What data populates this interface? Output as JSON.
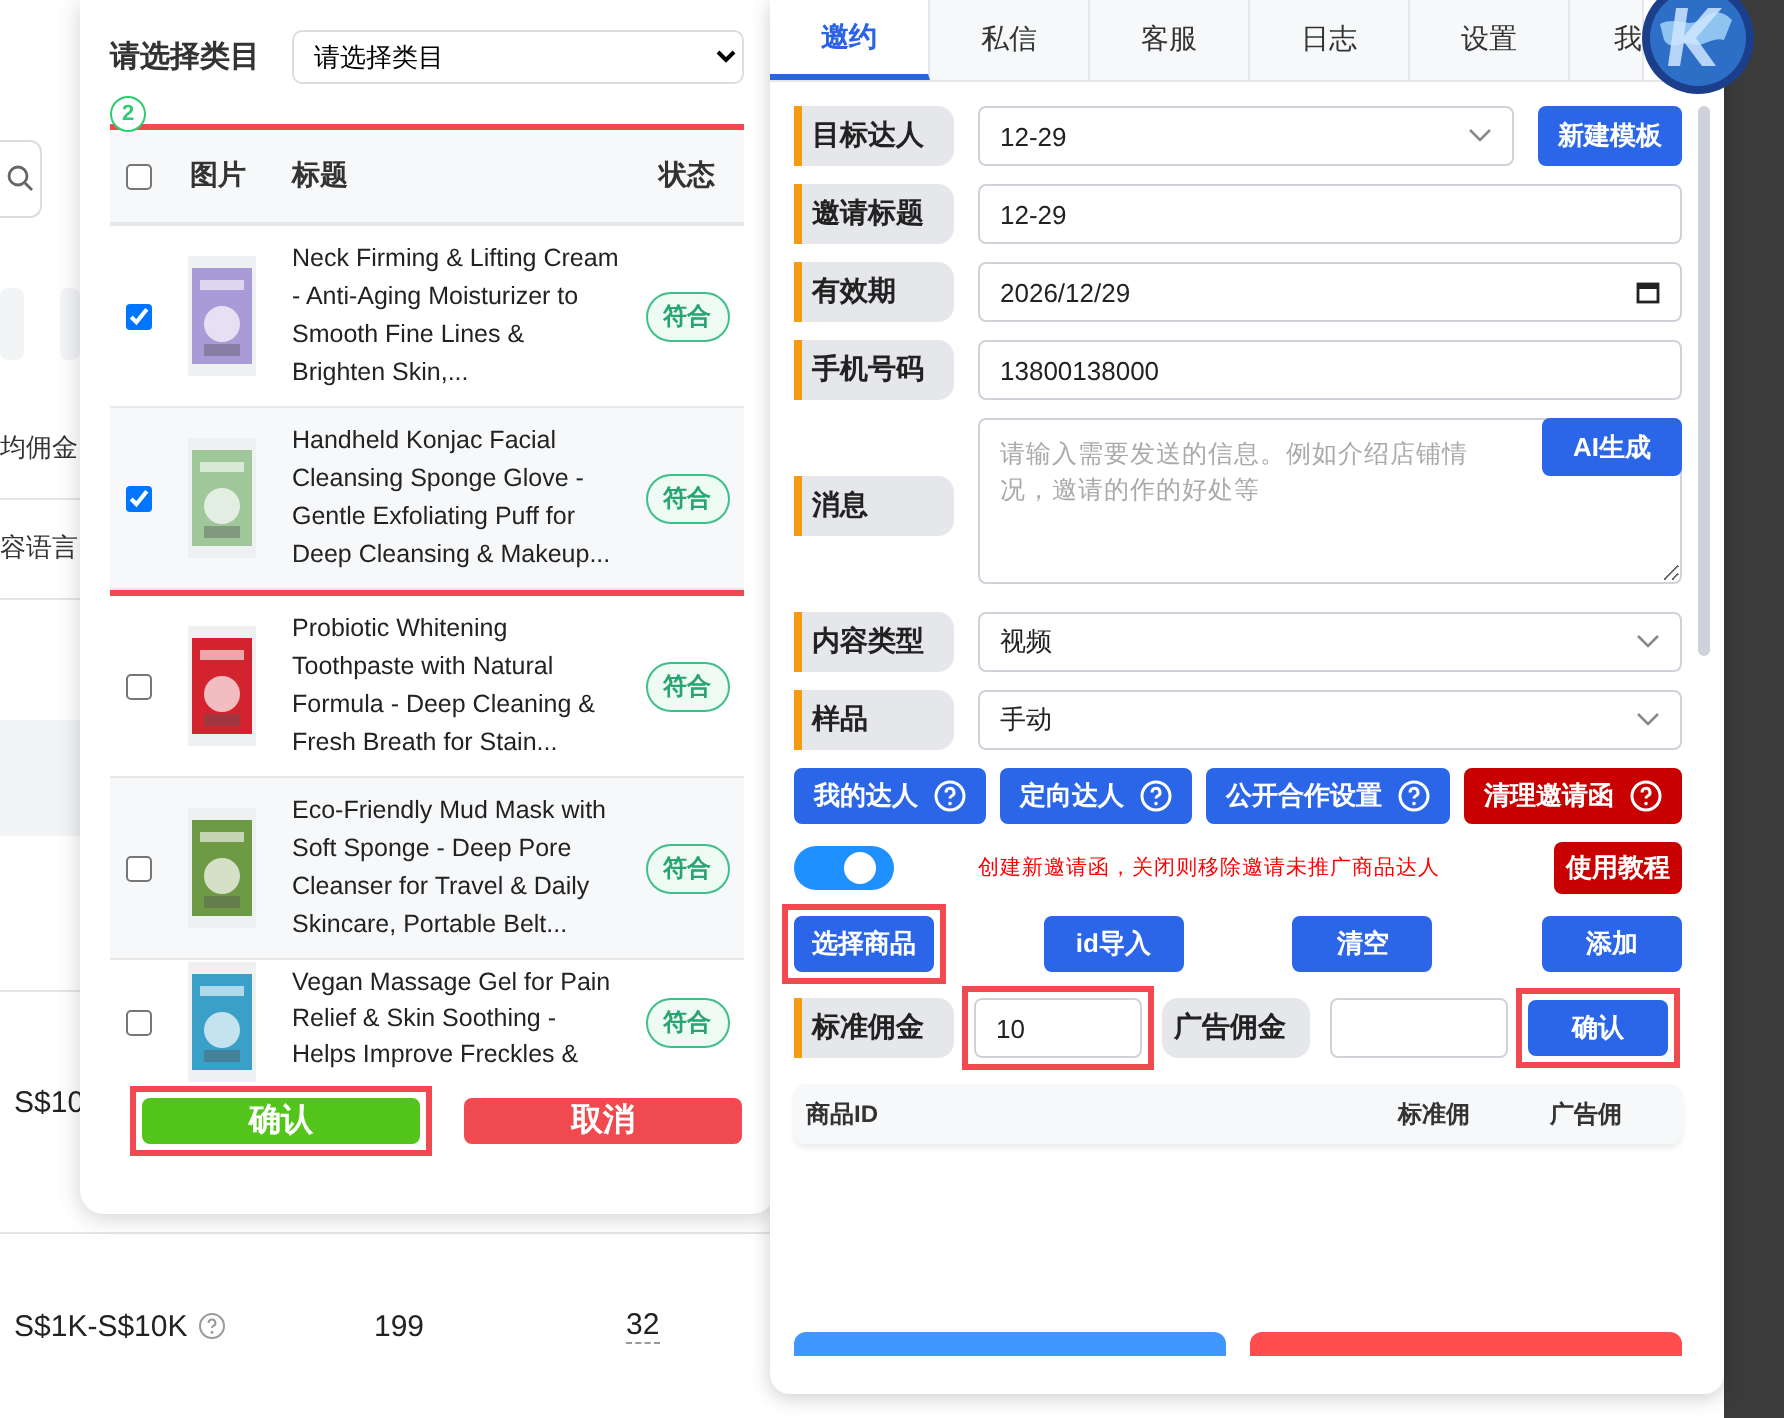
{
  "background_page": {
    "filter_labels": [
      "均佣金",
      "容语言"
    ],
    "rows": [
      {
        "column_1": "S$10"
      },
      {
        "column_1": "S$1K-S$10K",
        "column_2": "199",
        "column_3": "32"
      }
    ]
  },
  "product_picker": {
    "category_label": "请选择类目",
    "category_select": {
      "value": "请选择类目"
    },
    "step_marker": "2",
    "columns": [
      "图片",
      "标题",
      "状态"
    ],
    "select_all": {
      "checked": false
    },
    "header_highlighted": true,
    "products": [
      {
        "checked": true,
        "highlighted": true,
        "title": "Neck Firming & Lifting Cream - Anti-Aging Moisturizer to Smooth Fine Lines & Brighten Skin,...",
        "status": "符合"
      },
      {
        "checked": true,
        "highlighted": true,
        "title": "Handheld Konjac Facial Cleansing Sponge Glove - Gentle Exfoliating Puff for Deep Cleansing & Makeup...",
        "status": "符合"
      },
      {
        "checked": false,
        "highlighted": false,
        "title": "Probiotic Whitening Toothpaste with Natural Formula - Deep Cleaning & Fresh Breath for Stain...",
        "status": "符合"
      },
      {
        "checked": false,
        "highlighted": false,
        "title": "Eco-Friendly Mud Mask with Soft Sponge - Deep Pore Cleanser for Travel & Daily Skincare, Portable Belt...",
        "status": "符合"
      },
      {
        "checked": false,
        "highlighted": false,
        "title": "Vegan Massage Gel for Pain Relief & Skin Soothing - Helps Improve Freckles &",
        "status": "符合"
      }
    ],
    "buttons": [
      {
        "label": "确认",
        "kind": "confirm",
        "highlighted": true
      },
      {
        "label": "取消",
        "kind": "cancel",
        "highlighted": false
      }
    ]
  },
  "panel": {
    "tabs": [
      {
        "label": "邀约",
        "selected": true
      },
      {
        "label": "私信",
        "selected": false
      },
      {
        "label": "客服",
        "selected": false
      },
      {
        "label": "日志",
        "selected": false
      },
      {
        "label": "设置",
        "selected": false
      },
      {
        "label": "我",
        "selected": false
      }
    ],
    "fields": [
      {
        "kind": "select",
        "label": "目标达人",
        "value": "12-29",
        "button": "新建模板"
      },
      {
        "kind": "text",
        "label": "邀请标题",
        "value": "12-29"
      },
      {
        "kind": "date",
        "label": "有效期",
        "value": "2026/12/29"
      },
      {
        "kind": "text",
        "label": "手机号码",
        "value": "13800138000"
      },
      {
        "kind": "textarea",
        "label": "消息",
        "placeholder": "请输入需要发送的信息。例如介绍店铺情况，邀请的作的好处等",
        "button": "AI生成"
      },
      {
        "kind": "select",
        "label": "内容类型",
        "value": "视频"
      },
      {
        "kind": "select",
        "label": "样品",
        "value": "手动"
      }
    ],
    "help_buttons": [
      {
        "label": "我的达人",
        "kind": "primary"
      },
      {
        "label": "定向达人",
        "kind": "primary"
      },
      {
        "label": "公开合作设置",
        "kind": "primary"
      },
      {
        "label": "清理邀请函",
        "kind": "danger"
      }
    ],
    "toggle": {
      "on": true,
      "note": "创建新邀请函，关闭则移除邀请未推广商品达人",
      "button": "使用教程"
    },
    "actions": [
      {
        "label": "选择商品",
        "highlighted": true
      },
      {
        "label": "id导入",
        "highlighted": false
      },
      {
        "label": "清空",
        "highlighted": false
      },
      {
        "label": "添加",
        "highlighted": false
      }
    ],
    "commission": {
      "standard_label": "标准佣金",
      "standard_value": "10",
      "standard_highlighted": true,
      "ad_label": "广告佣金",
      "confirm": "确认",
      "confirm_highlighted": true
    },
    "table": {
      "columns": [
        "商品ID",
        "标准佣",
        "广告佣"
      ]
    },
    "bottom_buttons": [
      {
        "kind": "primary"
      },
      {
        "kind": "danger"
      }
    ]
  }
}
